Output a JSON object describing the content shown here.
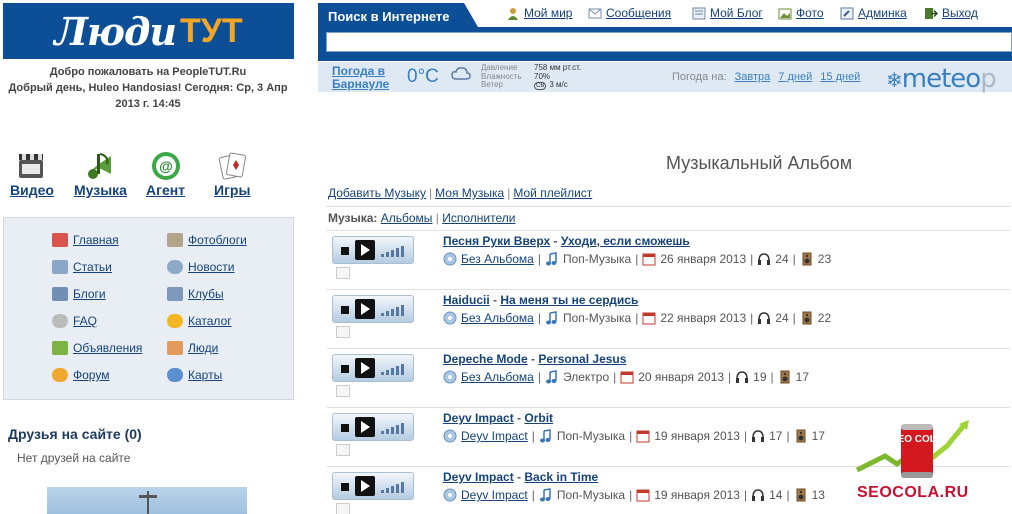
{
  "logo": {
    "part1": "Люди",
    "part2": "ТУТ"
  },
  "welcome": {
    "line1": "Добро пожаловать на PeopleTUT.Ru",
    "line2": "Добрый день, Huleo Handosias! Сегодня: Ср, 3 Апр",
    "line3": "2013 г. 14:45"
  },
  "quicklinks": [
    {
      "label": "Видео",
      "icon": "video-icon"
    },
    {
      "label": "Музыка",
      "icon": "music-icon"
    },
    {
      "label": "Агент",
      "icon": "agent-icon"
    },
    {
      "label": "Игры",
      "icon": "cards-icon"
    }
  ],
  "menu": {
    "left": [
      "Главная",
      "Статьи",
      "Блоги",
      "FAQ",
      "Объявления",
      "Форум"
    ],
    "right": [
      "Фотоблоги",
      "Новости",
      "Клубы",
      "Каталог",
      "Люди",
      "Карты"
    ]
  },
  "friends": {
    "title": "Друзья на сайте (0)",
    "empty": "Нет друзей на сайте"
  },
  "topbar": {
    "search_label": "Поиск в Интернете",
    "nav": [
      "Мой мир",
      "Сообщения",
      "Мой Блог",
      "Фото",
      "Админка",
      "Выход"
    ]
  },
  "weather": {
    "city_line1": "Погода в",
    "city_line2": "Барнауле",
    "temp": "0°C",
    "labels": [
      "Давление",
      "Влажность",
      "Ветер"
    ],
    "values": [
      "758 мм рт.ст.",
      "70%",
      "3 м/с"
    ],
    "wind_dir": "СВ",
    "forecast_label": "Погода на:",
    "forecast_links": [
      "Завтра",
      "7 дней",
      "15 дней"
    ],
    "brand": "meteo",
    "brand_fade": "p"
  },
  "album": {
    "title": "Музыкальный Альбом",
    "actions": [
      "Добавить Музыку",
      "Моя Музыка",
      "Мой плейлист"
    ],
    "filter_label": "Музыка:",
    "filters": [
      "Альбомы",
      "Исполнители"
    ]
  },
  "tracks": [
    {
      "artist": "Песня Руки Вверх",
      "title": "Уходи, если сможешь",
      "album": "Без Альбома",
      "genre": "Поп-Музыка",
      "date": "26 января 2013",
      "listens": "24",
      "downloads": "23"
    },
    {
      "artist": "Haiducii",
      "title": "На меня ты не сердись",
      "album": "Без Альбома",
      "genre": "Поп-Музыка",
      "date": "22 января 2013",
      "listens": "24",
      "downloads": "22"
    },
    {
      "artist": "Depeche Mode",
      "title": "Personal Jesus",
      "album": "Без Альбома",
      "genre": "Электро",
      "date": "20 января 2013",
      "listens": "19",
      "downloads": "17"
    },
    {
      "artist": "Deyv Impact",
      "title": "Orbit",
      "album": "Deyv Impact",
      "genre": "Поп-Музыка",
      "date": "19 января 2013",
      "listens": "17",
      "downloads": "17"
    },
    {
      "artist": "Deyv Impact",
      "title": "Back in Time",
      "album": "Deyv Impact",
      "genre": "Поп-Музыка",
      "date": "19 января 2013",
      "listens": "14",
      "downloads": "13"
    }
  ],
  "watermark": {
    "text": "SEOCOLA.RU",
    "can_text": "SEO COLA"
  },
  "colors": {
    "brand_blue": "#0d4f96",
    "accent_orange": "#f5a623",
    "link_blue": "#15437a"
  }
}
